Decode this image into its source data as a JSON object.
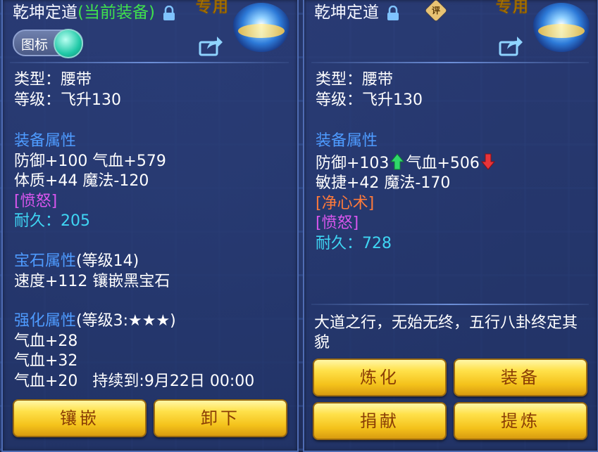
{
  "left": {
    "title": "乾坤定道",
    "current_tag": "(当前装备)",
    "badge": "专用",
    "toggle_label": "图标",
    "type_line": "类型：腰带",
    "level_line": "等级：飞升130",
    "equip_attr_header": "装备属性",
    "attr1": "防御+100 气血+579",
    "attr2": "体质+44 魔法-120",
    "special": "[愤怒]",
    "durability": "耐久：205",
    "gem_header": "宝石属性",
    "gem_level": "(等级14)",
    "gem_line": "速度+112 镶嵌黑宝石",
    "enhance_header": "强化属性",
    "enhance_level": "(等级3:★★★)",
    "enhance1": "气血+28",
    "enhance2": "气血+32",
    "enhance3": "气血+20",
    "enhance3_expire": "持续到:9月22日 00:00",
    "buttons": {
      "inlay": "镶嵌",
      "unequip": "卸下"
    }
  },
  "right": {
    "title": "乾坤定道",
    "ping_label": "评",
    "badge": "专用",
    "type_line": "类型：腰带",
    "level_line": "等级：飞升130",
    "equip_attr_header": "装备属性",
    "attr1_a": "防御+103",
    "attr1_b": "气血+506",
    "attr2": "敏捷+42 魔法-170",
    "special1": "[净心术]",
    "special2": "[愤怒]",
    "durability": "耐久：728",
    "description": "大道之行，无始无终，五行八卦终定其貌",
    "buttons": {
      "refine": "炼化",
      "equip": "装备",
      "donate": "捐献",
      "extract": "提炼"
    }
  },
  "icons": [
    "lock-icon",
    "share-icon",
    "ping-icon",
    "up-arrow-icon",
    "down-arrow-icon",
    "emblem-icon"
  ],
  "colors": {
    "header_blue": "#4e9bff",
    "special_pink": "#d956ee",
    "special_orange": "#ff7a3a",
    "durability_cyan": "#3fd6f4",
    "current_green": "#3fe04d",
    "button_gold": "#f4c21b",
    "up_green": "#2fd86a",
    "down_red": "#e8343a"
  }
}
